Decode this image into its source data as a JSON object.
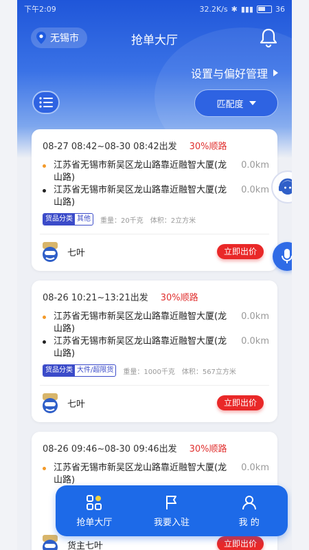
{
  "status_bar": {
    "time": "下午2:09",
    "net_speed": "32.2K/s",
    "battery": "36"
  },
  "header": {
    "city": "无锡市",
    "title": "抢单大厅",
    "settings_link": "设置与偏好管理",
    "match_button": "匹配度"
  },
  "orders": [
    {
      "time_range": "08-27 08:42~08-30 08:42出发",
      "match_pct": "30%顺路",
      "pickup": {
        "address": "江苏省无锡市新吴区龙山路靠近融智大厦(龙山路)",
        "distance": "0.0km"
      },
      "dropoff": {
        "address": "江苏省无锡市新吴区龙山路靠近融智大厦(龙山路)",
        "distance": "0.0km"
      },
      "tag_key": "货品分类",
      "tag_value": "其他",
      "weight": "重量：20千克",
      "volume": "体积：2立方米",
      "owner": "七叶",
      "bid_label": "立即出价"
    },
    {
      "time_range": "08-26 10:21~13:21出发",
      "match_pct": "30%顺路",
      "pickup": {
        "address": "江苏省无锡市新吴区龙山路靠近融智大厦(龙山路)",
        "distance": "0.0km"
      },
      "dropoff": {
        "address": "江苏省无锡市新吴区龙山路靠近融智大厦(龙山路)",
        "distance": "0.0km"
      },
      "tag_key": "货品分类",
      "tag_value": "大件/超限货",
      "weight": "重量：1000千克",
      "volume": "体积：567立方米",
      "owner": "七叶",
      "bid_label": "立即出价"
    },
    {
      "time_range": "08-26 09:46~08-30 09:46出发",
      "match_pct": "30%顺路",
      "pickup": {
        "address": "江苏省无锡市新吴区龙山路靠近融智大厦(龙山路)",
        "distance": "0.0km"
      },
      "owner": "货主七叶",
      "bid_label": "立即出价"
    }
  ],
  "bottom_nav": [
    {
      "label": "抢单大厅",
      "icon": "grid-icon"
    },
    {
      "label": "我要入驻",
      "icon": "flag-icon"
    },
    {
      "label": "我 的",
      "icon": "user-icon"
    }
  ],
  "colors": {
    "primary": "#1d6ae8",
    "accent_red": "#e92828",
    "tag_blue": "#3b4bc9"
  }
}
